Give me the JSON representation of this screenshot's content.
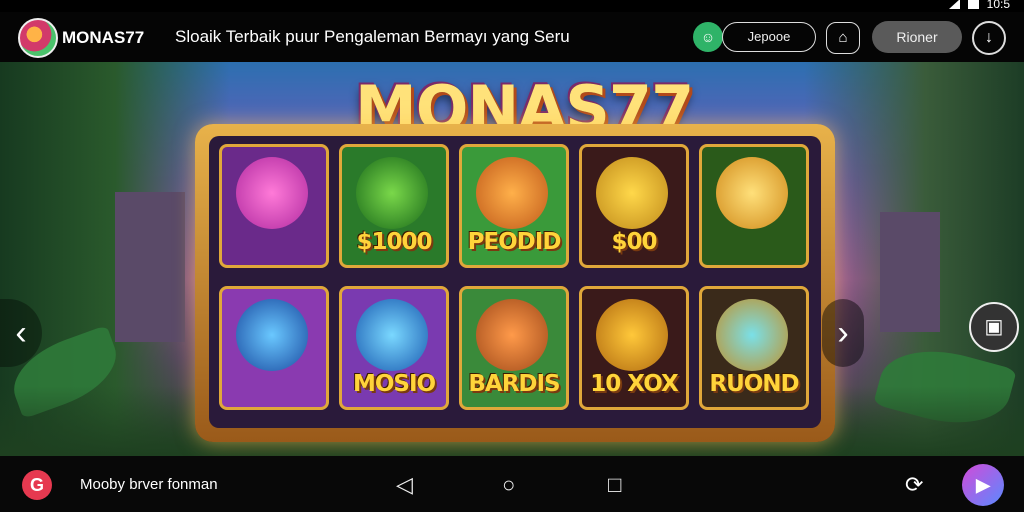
{
  "status_bar": {
    "time": "10:5"
  },
  "header": {
    "app_name": "MONAS77",
    "tagline": "Sloaik Terbaik puur Pengaleman Bermayı yang Seru",
    "pill_outline_label": "Jepooe",
    "pill_filled_label": "Rioner",
    "icons": [
      "chat-icon",
      "bell-icon",
      "download-icon"
    ]
  },
  "game": {
    "title": "MONAS77",
    "reels": [
      {
        "label": "",
        "art": "pink-orb",
        "color": "#6a2a8a"
      },
      {
        "label": "$1000",
        "art": "green-leaf",
        "color": "#2a7a2a"
      },
      {
        "label": "PEODID",
        "art": "lion-face",
        "color": "#3a9a3a"
      },
      {
        "label": "$00",
        "art": "gold-block",
        "color": "#3a1a1a"
      },
      {
        "label": "",
        "art": "gold-bar",
        "color": "#2a5a1a"
      },
      {
        "label": "",
        "art": "blue-panther",
        "color": "#8a3ab0"
      },
      {
        "label": "MOSIO",
        "art": "blue-gem",
        "color": "#7a3ab0"
      },
      {
        "label": "BARDIS",
        "art": "tiger-face",
        "color": "#3a8a3a"
      },
      {
        "label": "10 XOX",
        "art": "gold-ten",
        "color": "#3a1a1a"
      },
      {
        "label": "RUOND",
        "art": "water-bowl",
        "color": "#3a2a1a"
      }
    ]
  },
  "bottom_bar": {
    "text": "Mooby brver fonman",
    "nav": [
      "back-icon",
      "home-icon",
      "recents-icon"
    ]
  }
}
